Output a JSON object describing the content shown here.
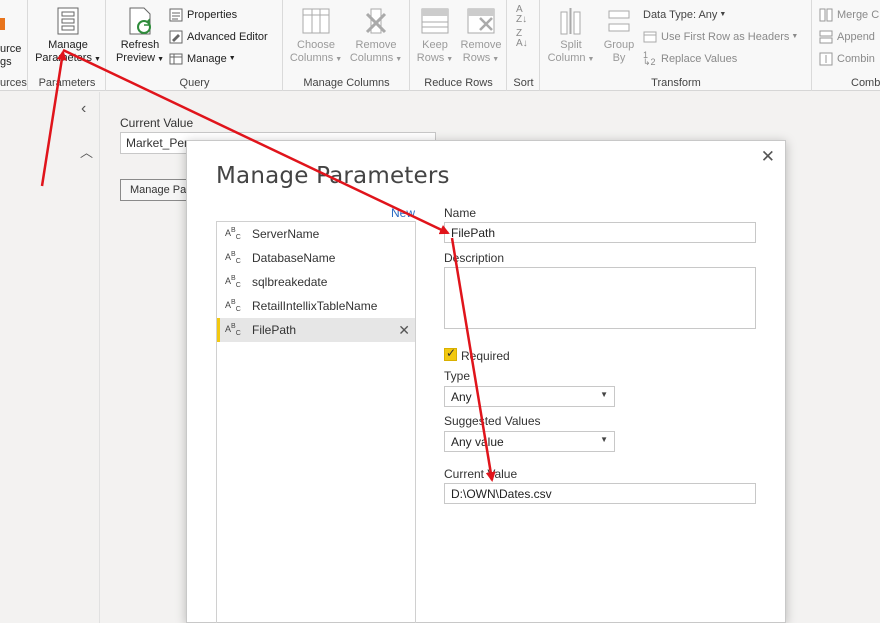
{
  "ribbon": {
    "source_label_line1": "urce",
    "source_label_line2": "gs",
    "sources_group": "urces",
    "manage_params_line1": "Manage",
    "manage_params_line2": "Parameters",
    "parameters_group": "Parameters",
    "refresh_line1": "Refresh",
    "refresh_line2": "Preview",
    "properties": "Properties",
    "advanced_editor": "Advanced Editor",
    "manage": "Manage",
    "query_group": "Query",
    "choose_columns_line1": "Choose",
    "choose_columns_line2": "Columns",
    "remove_columns_line1": "Remove",
    "remove_columns_line2": "Columns",
    "manage_columns_group": "Manage Columns",
    "keep_rows_line1": "Keep",
    "keep_rows_line2": "Rows",
    "remove_rows_line1": "Remove",
    "remove_rows_line2": "Rows",
    "reduce_rows_group": "Reduce Rows",
    "sort_group": "Sort",
    "split_column_line1": "Split",
    "split_column_line2": "Column",
    "group_by_line1": "Group",
    "group_by_line2": "By",
    "data_type": "Data Type: Any",
    "use_first_row": "Use First Row as Headers",
    "replace_values": "Replace Values",
    "transform_group": "Transform",
    "merge": "Merge C",
    "append": "Append",
    "combine": "Combin",
    "combine_group": "Comb"
  },
  "background": {
    "current_value_label": "Current Value",
    "current_value": "Market_Per",
    "manage_params_button": "Manage Par"
  },
  "dialog": {
    "title": "Manage Parameters",
    "close": "✕",
    "new_link": "New",
    "parameters": [
      {
        "name": "ServerName"
      },
      {
        "name": "DatabaseName"
      },
      {
        "name": "sqlbreakedate"
      },
      {
        "name": "RetailIntellixTableName"
      },
      {
        "name": "FilePath"
      }
    ],
    "selected_index": 4,
    "name_label": "Name",
    "name_value": "FilePath",
    "description_label": "Description",
    "required_label": "Required",
    "required_checked": true,
    "type_label": "Type",
    "type_value": "Any",
    "suggested_values_label": "Suggested Values",
    "suggested_values_value": "Any value",
    "current_value_label": "Current Value",
    "current_value": "D:\\OWN\\Dates.csv"
  },
  "colors": {
    "accent": "#f2c811",
    "link": "#2b6cc4",
    "annotation": "#e0141b"
  }
}
